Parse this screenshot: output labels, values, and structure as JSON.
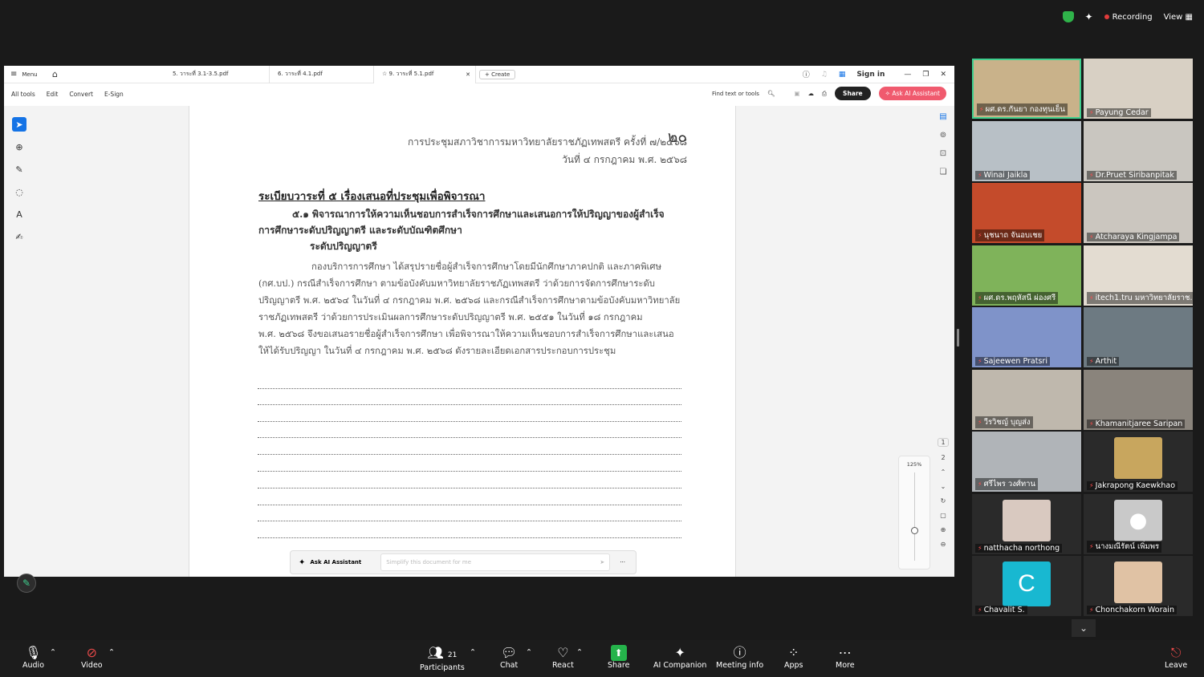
{
  "top_right": {
    "recording_label": "Recording",
    "view_label": "View"
  },
  "pdf": {
    "menu_label": "Menu",
    "tabs": [
      {
        "label": "5. วาระที่ 3.1-3.5.pdf"
      },
      {
        "label": "6. วาระที่ 4.1.pdf"
      },
      {
        "label": "9. วาระที่ 5.1.pdf"
      }
    ],
    "create_label": "Create",
    "sign_in": "Sign in",
    "toolbar": {
      "all_tools": "All tools",
      "edit": "Edit",
      "convert": "Convert",
      "esign": "E-Sign"
    },
    "find_placeholder": "Find text or tools",
    "share_label": "Share",
    "ask_ai_label": "Ask AI Assistant",
    "zoom_level": "125%",
    "page_numbers": [
      "1",
      "2"
    ],
    "ai_bar": {
      "label": "Ask AI Assistant",
      "placeholder": "Simplify this document for me"
    }
  },
  "document": {
    "page_number": "๒๐",
    "header_line1": "การประชุมสภาวิชาการมหาวิทยาลัยราชภัฏเทพสตรี ครั้งที่ ๗/๒๕๖๘",
    "header_line2": "วันที่ ๔ กรกฎาคม พ.ศ. ๒๕๖๘",
    "agenda_title": "ระเบียบวาระที่   ๕ เรื่องเสนอที่ประชุมเพื่อพิจารณา",
    "item_line1": "๕.๑ พิจารณาการให้ความเห็นชอบการสำเร็จการศึกษาและเสนอการให้ปริญญาของผู้สำเร็จ",
    "item_line2": "การศึกษาระดับปริญญาตรี และระดับบัณฑิตศึกษา",
    "item_line3": "ระดับปริญญาตรี",
    "para": [
      "กองบริการการศึกษา ได้สรุปรายชื่อผู้สำเร็จการศึกษาโดยมีนักศึกษาภาคปกติ และภาคพิเศษ",
      "(กศ.บป.) กรณีสำเร็จการศึกษา ตามข้อบังคับมหาวิทยาลัยราชภัฏเทพสตรี ว่าด้วยการจัดการศึกษาระดับ",
      "ปริญญาตรี พ.ศ. ๒๕๖๔ ในวันที่ ๔ กรกฎาคม พ.ศ. ๒๕๖๘ และกรณีสำเร็จการศึกษาตามข้อบังคับมหาวิทยาลัย",
      "ราชภัฏเทพสตรี ว่าด้วยการประเมินผลการศึกษาระดับปริญญาตรี พ.ศ. ๒๕๕๑ ในวันที่ ๑๘ กรกฎาคม",
      "พ.ศ. ๒๕๖๘ จึงขอเสนอรายชื่อผู้สำเร็จการศึกษา เพื่อพิจารณาให้ความเห็นชอบการสำเร็จการศึกษาและเสนอ",
      "ให้ได้รับปริญญา ในวันที่ ๔ กรกฎาคม พ.ศ. ๒๕๖๘  ดังรายละเอียดเอกสารประกอบการประชุม"
    ]
  },
  "participants": [
    {
      "name": "ผศ.ดร.กันยา กองทุนเย็น",
      "color": "#c9b28a"
    },
    {
      "name": "Payung Cedar",
      "color": "#d8d0c4"
    },
    {
      "name": "Winai Jaikla",
      "color": "#b8c0c6"
    },
    {
      "name": "Dr.Pruet Siribanpitak",
      "color": "#c9c6c0"
    },
    {
      "name": "นุชนาถ จันอบเชย",
      "color": "#c44b2b"
    },
    {
      "name": "Atcharaya Kingjampa",
      "color": "#cbc6bf"
    },
    {
      "name": "ผศ.ดร.พฤหัสนี ผ่องศรี",
      "color": "#7fb35a"
    },
    {
      "name": "itech1.tru มหาวิทยาลัยราช...",
      "color": "#e3dcd1"
    },
    {
      "name": "Sajeewen Pratsri",
      "color": "#7f93c9"
    },
    {
      "name": "Arthit",
      "color": "#6d7a82"
    },
    {
      "name": "วีรวิชญ์ บุญส่ง",
      "color": "#bfb8ad"
    },
    {
      "name": "Khamanitjaree Saripan",
      "color": "#8a847c"
    },
    {
      "name": "ศรีไพร วงศ์ทาน",
      "color": "#b0b4b8"
    },
    {
      "name": "Jakrapong Kaewkhao",
      "color": "#2a2a2a"
    },
    {
      "name": "natthacha northong",
      "color": "#2a2a2a"
    },
    {
      "name": "นางมณีรัตน์ เพิ่มพร",
      "color": "#2a2a2a"
    },
    {
      "name": "Chavalit S.",
      "color": "#2a2a2a"
    },
    {
      "name": "Chonchakorn Worain",
      "color": "#2a2a2a"
    }
  ],
  "bottom_bar": {
    "audio": "Audio",
    "video": "Video",
    "participants": "Participants",
    "participants_count": "21",
    "chat": "Chat",
    "react": "React",
    "share": "Share",
    "ai_companion": "AI Companion",
    "meeting_info": "Meeting info",
    "apps": "Apps",
    "more": "More",
    "leave": "Leave"
  },
  "avatar_letter": "C"
}
